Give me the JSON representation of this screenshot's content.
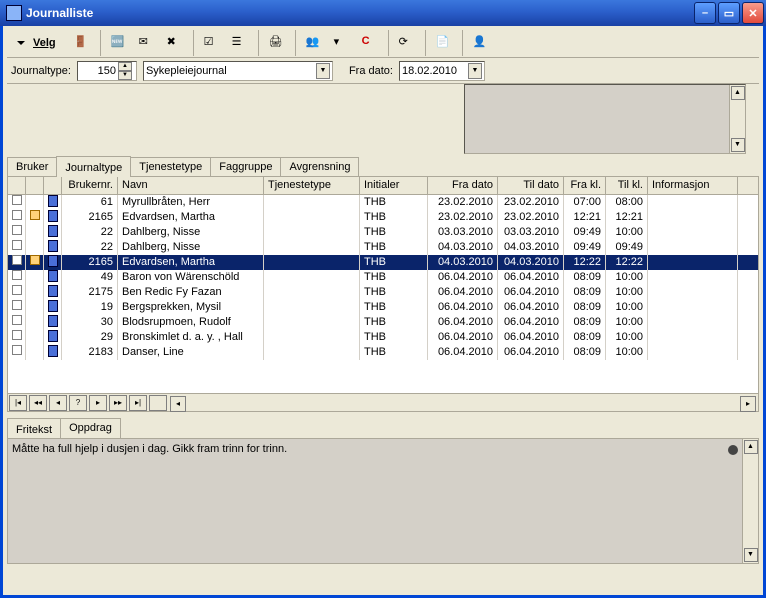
{
  "window": {
    "title": "Journalliste"
  },
  "toolbar": {
    "velg": "Velg",
    "icons": [
      "door",
      "new-doc",
      "inbox",
      "delete-doc",
      "check-list",
      "col-list",
      "print",
      "group",
      "sort-asc",
      "circle-c",
      "refresh",
      "copy",
      "person-export"
    ]
  },
  "filter": {
    "journaltype_label": "Journaltype:",
    "journaltype_value": "150",
    "journaltype_combo": "Sykepleiejournal",
    "fradato_label": "Fra dato:",
    "fradato_value": "18.02.2010"
  },
  "tabs_top": [
    "Bruker",
    "Journaltype",
    "Tjenestetype",
    "Faggruppe",
    "Avgrensning"
  ],
  "tabs_top_active": 1,
  "grid": {
    "headers": [
      "",
      "",
      "",
      "Brukernr.",
      "Navn",
      "Tjenestetype",
      "Initialer",
      "Fra dato",
      "Til dato",
      "Fra kl.",
      "Til kl.",
      "Informasjon"
    ],
    "selected": 4,
    "rows": [
      {
        "lock": false,
        "brukernr": "61",
        "navn": "Myrullbråten, Herr",
        "tjeneste": "",
        "init": "THB",
        "fra": "23.02.2010",
        "til": "23.02.2010",
        "frakl": "07:00",
        "tilkl": "08:00"
      },
      {
        "lock": true,
        "brukernr": "2165",
        "navn": "Edvardsen, Martha",
        "tjeneste": "",
        "init": "THB",
        "fra": "23.02.2010",
        "til": "23.02.2010",
        "frakl": "12:21",
        "tilkl": "12:21"
      },
      {
        "lock": false,
        "brukernr": "22",
        "navn": "Dahlberg, Nisse",
        "tjeneste": "",
        "init": "THB",
        "fra": "03.03.2010",
        "til": "03.03.2010",
        "frakl": "09:49",
        "tilkl": "10:00"
      },
      {
        "lock": false,
        "brukernr": "22",
        "navn": "Dahlberg, Nisse",
        "tjeneste": "",
        "init": "THB",
        "fra": "04.03.2010",
        "til": "04.03.2010",
        "frakl": "09:49",
        "tilkl": "09:49"
      },
      {
        "lock": true,
        "brukernr": "2165",
        "navn": "Edvardsen, Martha",
        "tjeneste": "",
        "init": "THB",
        "fra": "04.03.2010",
        "til": "04.03.2010",
        "frakl": "12:22",
        "tilkl": "12:22"
      },
      {
        "lock": false,
        "brukernr": "49",
        "navn": "Baron von Wärenschöld",
        "tjeneste": "",
        "init": "THB",
        "fra": "06.04.2010",
        "til": "06.04.2010",
        "frakl": "08:09",
        "tilkl": "10:00"
      },
      {
        "lock": false,
        "brukernr": "2175",
        "navn": "Ben Redic Fy Fazan",
        "tjeneste": "",
        "init": "THB",
        "fra": "06.04.2010",
        "til": "06.04.2010",
        "frakl": "08:09",
        "tilkl": "10:00"
      },
      {
        "lock": false,
        "brukernr": "19",
        "navn": "Bergsprekken, Mysil",
        "tjeneste": "",
        "init": "THB",
        "fra": "06.04.2010",
        "til": "06.04.2010",
        "frakl": "08:09",
        "tilkl": "10:00"
      },
      {
        "lock": false,
        "brukernr": "30",
        "navn": "Blodsrupmoen, Rudolf",
        "tjeneste": "",
        "init": "THB",
        "fra": "06.04.2010",
        "til": "06.04.2010",
        "frakl": "08:09",
        "tilkl": "10:00"
      },
      {
        "lock": false,
        "brukernr": "29",
        "navn": "Bronskimlet d. a. y. , Hall",
        "tjeneste": "",
        "init": "THB",
        "fra": "06.04.2010",
        "til": "06.04.2010",
        "frakl": "08:09",
        "tilkl": "10:00"
      },
      {
        "lock": false,
        "brukernr": "2183",
        "navn": "Danser, Line",
        "tjeneste": "",
        "init": "THB",
        "fra": "06.04.2010",
        "til": "06.04.2010",
        "frakl": "08:09",
        "tilkl": "10:00"
      }
    ]
  },
  "tabs_bottom": [
    "Fritekst",
    "Oppdrag"
  ],
  "tabs_bottom_active": 0,
  "detail_text": "Måtte ha full hjelp i dusjen i dag. Gikk fram trinn for trinn."
}
